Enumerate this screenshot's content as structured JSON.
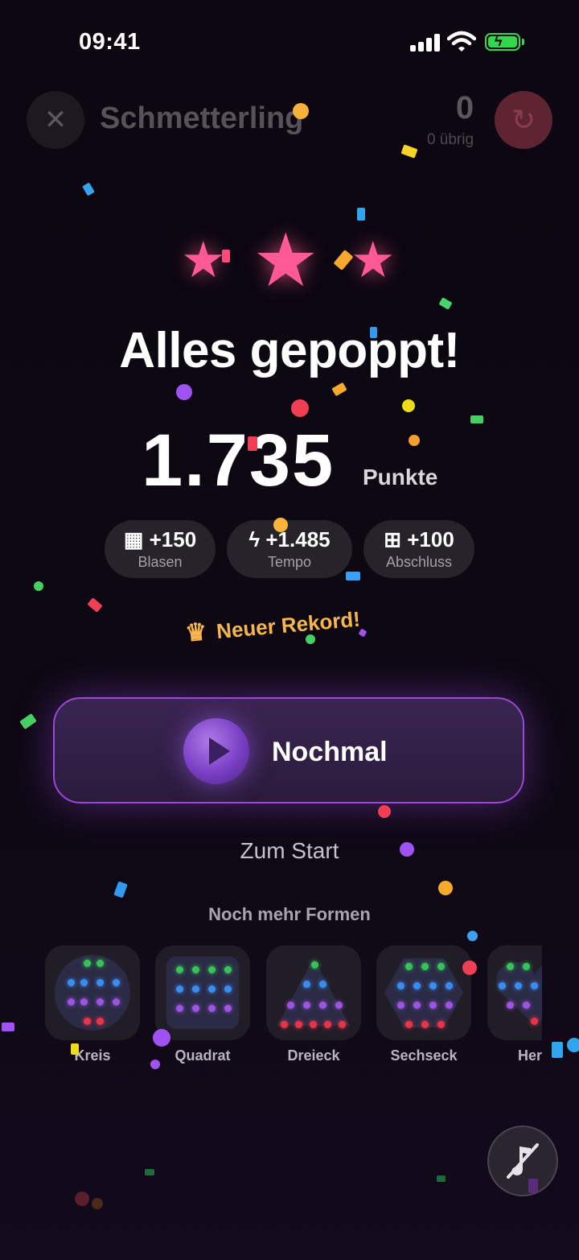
{
  "status_bar": {
    "time": "09:41"
  },
  "header": {
    "title": "Schmetterling",
    "score": "0",
    "remaining": "0 übrig"
  },
  "result": {
    "stars_earned": 3,
    "stars_total": 3,
    "headline": "Alles gepoppt!",
    "score": "1.735",
    "score_unit": "Punkte",
    "breakdown": [
      {
        "icon": "grid-icon",
        "value": "+150",
        "label": "Blasen"
      },
      {
        "icon": "lightning-icon",
        "value": "+1.485",
        "label": "Tempo"
      },
      {
        "icon": "gift-icon",
        "value": "+100",
        "label": "Abschluss"
      }
    ],
    "record": "Neuer Rekord!"
  },
  "actions": {
    "again_label": "Nochmal",
    "home_label": "Zum Start"
  },
  "more_shapes": {
    "heading": "Noch mehr Formen",
    "items": [
      {
        "label": "Kreis"
      },
      {
        "label": "Quadrat"
      },
      {
        "label": "Dreieck"
      },
      {
        "label": "Sechseck"
      },
      {
        "label": "Her"
      }
    ]
  },
  "colors": {
    "star": "#ff5a95",
    "accent_purple": "#9b48d6",
    "record_gold": "#f7b64d",
    "battery_green": "#32d74b"
  },
  "icons": {
    "close": "close-icon",
    "restart": "restart-icon",
    "play": "play-icon",
    "crown": "crown-icon",
    "mute": "sound-off-icon"
  }
}
